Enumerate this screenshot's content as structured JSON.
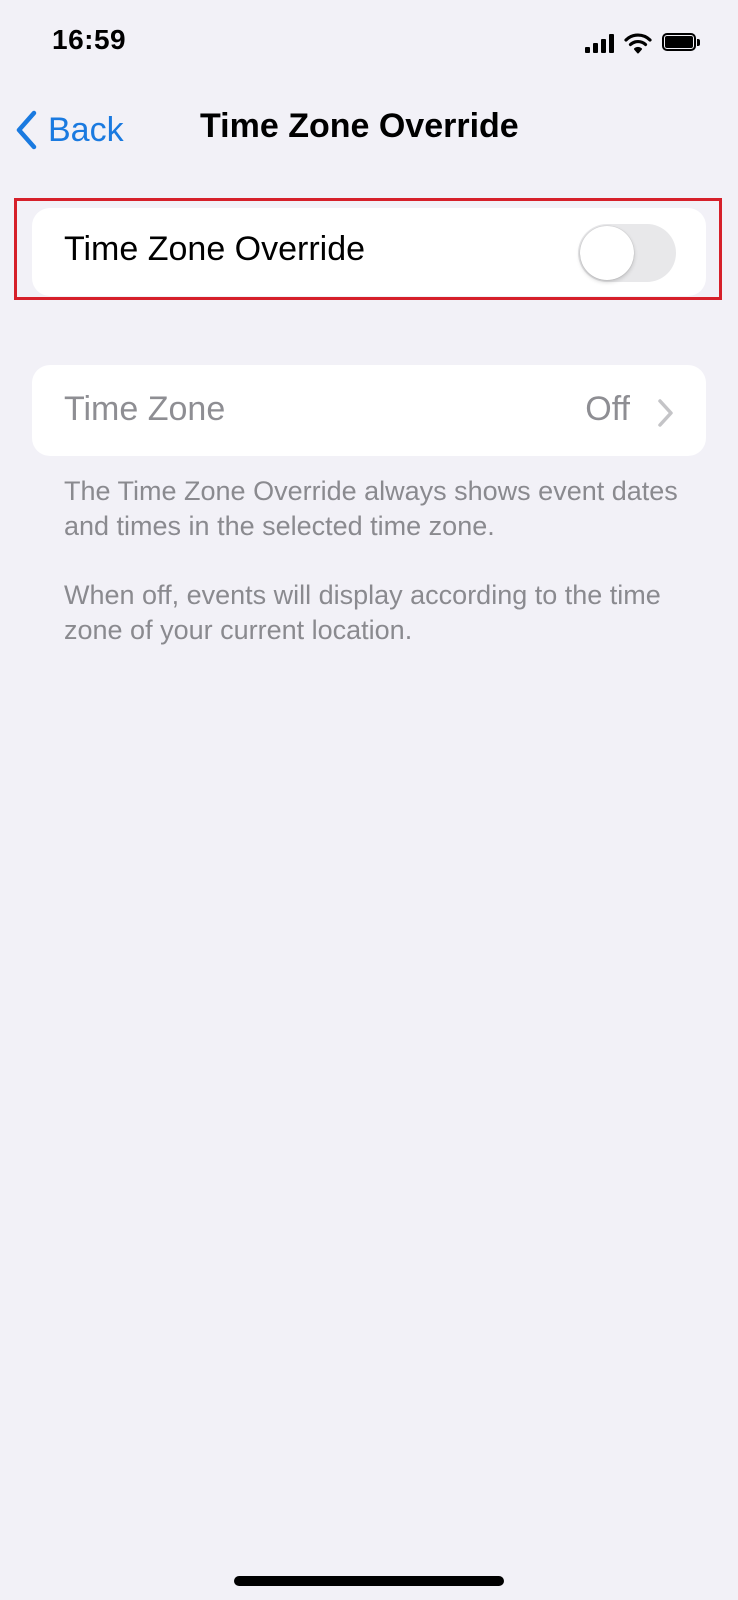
{
  "status_bar": {
    "time": "16:59"
  },
  "nav": {
    "back_label": "Back",
    "title": "Time Zone Override"
  },
  "override_row": {
    "label": "Time Zone Override",
    "toggle_on": false
  },
  "timezone_row": {
    "label": "Time Zone",
    "value": "Off"
  },
  "footer": {
    "text1": "The Time Zone Override always shows event dates and times in the selected time zone.",
    "text2": "When off, events will display according to the time zone of your current location."
  },
  "colors": {
    "accent": "#1a7ae0",
    "highlight": "#d6202a",
    "background": "#f2f1f7"
  },
  "icons": [
    "signal-icon",
    "wifi-icon",
    "battery-icon",
    "chevron-left-icon",
    "chevron-right-icon"
  ]
}
